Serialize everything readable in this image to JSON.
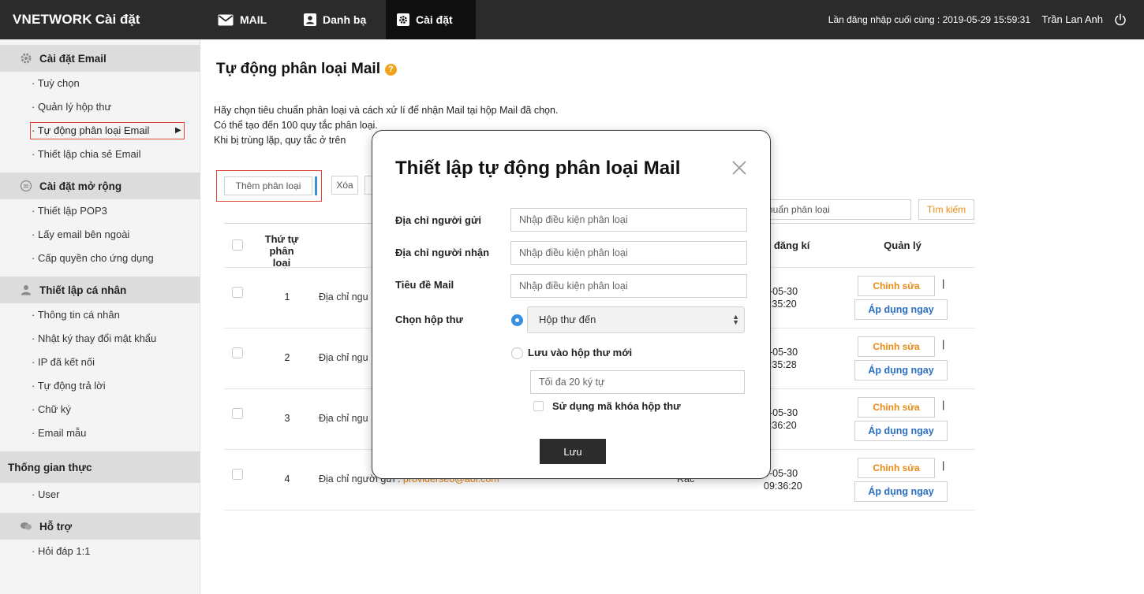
{
  "brand": {
    "name": "VNETWORK",
    "section": "Cài đặt"
  },
  "topnav": {
    "items": [
      {
        "label": "MAIL",
        "icon": "envelope-icon"
      },
      {
        "label": "Danh bạ",
        "icon": "contact-card-icon"
      },
      {
        "label": "Cài đặt",
        "icon": "settings-icon",
        "active": true
      }
    ],
    "last_login": "Lần đăng nhập cuối cùng : 2019-05-29 15:59:31",
    "user": "Trần Lan Anh"
  },
  "sidebar": {
    "sections": [
      {
        "title": "Cài đặt Email",
        "icon": "gear-icon",
        "items": [
          "Tuỳ chọn",
          "Quản lý hộp thư",
          "Tự động phân loại Email",
          "Thiết lập chia sẻ Email"
        ],
        "active_index": 2
      },
      {
        "title": "Cài đặt mở rộng",
        "icon": "extension-icon",
        "items": [
          "Thiết lập POP3",
          "Lấy email bên ngoài",
          "Cấp quyền cho ứng dụng"
        ]
      },
      {
        "title": "Thiết lập cá nhân",
        "icon": "person-icon",
        "items": [
          "Thông tin cá nhân",
          "Nhật ký thay đổi mật khẩu",
          "IP đã kết nối",
          "Tự động trả lời",
          "Chữ ký",
          "Email mẫu"
        ]
      },
      {
        "title": "Thống gian thực",
        "icon": "",
        "items": [
          "User"
        ]
      },
      {
        "title": "Hỗ trợ",
        "icon": "chat-bubbles-icon",
        "items": [
          "Hỏi đáp 1:1"
        ]
      }
    ]
  },
  "main": {
    "title": "Tự động phân loại Mail",
    "desc": [
      "Hãy chọn tiêu chuẩn phân loại và cách xử lí để nhận Mail tại hộp Mail đã chọn.",
      "Có thể tạo đến 100 quy tắc phân loại.",
      "Khi bị trùng lặp, quy tắc ở trên"
    ],
    "buttons": {
      "add": "Thêm phân loại",
      "delete": "Xóa"
    },
    "search": {
      "placeholder_visible": "huẩn phân loại",
      "button": "Tìm kiếm"
    },
    "table": {
      "headers": {
        "order": "Thứ tự phân loại",
        "date": "y đăng kí",
        "manage": "Quản lý"
      },
      "rows": [
        {
          "num": "1",
          "rule_label": "Địa chỉ ngu",
          "rule_value": "",
          "folder": "",
          "date": "9-05-30\n9:35:20"
        },
        {
          "num": "2",
          "rule_label": "Địa chỉ ngu",
          "rule_value": "",
          "folder": "",
          "date": "9-05-30\n9:35:28"
        },
        {
          "num": "3",
          "rule_label": "Địa chỉ ngu",
          "rule_value": "",
          "folder": "",
          "date": "9-05-30\n9:36:20"
        },
        {
          "num": "4",
          "rule_label": "Địa chỉ người gửi : ",
          "rule_value": "providerseo@aol.com",
          "folder": "Rác",
          "date": "9-05-30\n09:36:20"
        }
      ],
      "edit_label": "Chỉnh sửa",
      "apply_label": "Áp dụng ngay",
      "separator": "|"
    }
  },
  "modal": {
    "title": "Thiết lập tự động phân loại Mail",
    "fields": [
      {
        "label": "Địa chỉ người gửi",
        "placeholder": "Nhập điều kiện phân loại"
      },
      {
        "label": "Địa chỉ người nhận",
        "placeholder": "Nhập điều kiện phân loại"
      },
      {
        "label": "Tiêu đề Mail",
        "placeholder": "Nhập điều kiện phân loại"
      }
    ],
    "mailbox_label": "Chọn hộp thư",
    "mailbox_selected": "Hộp thư đến",
    "new_mailbox_label": "Lưu vào hộp thư mới",
    "new_mailbox_placeholder": "Tối đa 20 ký tự",
    "lock_label": "Sử dụng mã khóa hộp thư",
    "save": "Lưu"
  },
  "colors": {
    "topbar": "#2b2b2b",
    "accent_orange": "#e88a14",
    "accent_blue": "#2a6fc4",
    "highlight_red": "#e0483c"
  }
}
